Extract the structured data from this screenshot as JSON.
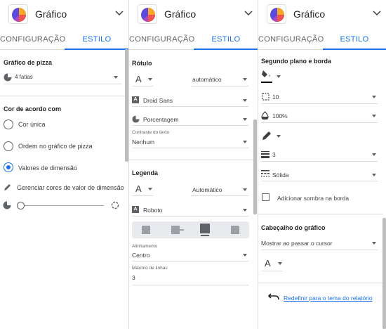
{
  "header": {
    "title": "Gráfico"
  },
  "tabs": {
    "config": "CONFIGURAÇÃO",
    "style": "ESTILO"
  },
  "panel1": {
    "pie_section": "Gráfico de pizza",
    "slices": "4 fatias",
    "color_section": "Cor de acordo com",
    "radio_single": "Cor única",
    "radio_order": "Ordem no gráfico de pizza",
    "radio_dimension": "Valores de dimensão",
    "manage_colors": "Gerenciar cores de valor de dimensão"
  },
  "panel2": {
    "label_section": "Rótulo",
    "label_font_size": "automático",
    "label_font": "Droid Sans",
    "label_type": "Porcentagem",
    "contrast_label": "Contraste do texto",
    "contrast_value": "Nenhum",
    "legend_section": "Legenda",
    "legend_font_size": "Automático",
    "legend_font": "Roboto",
    "align_label": "Alinhamento",
    "align_value": "Centro",
    "max_lines_label": "Máximo de linhas",
    "max_lines_value": "3"
  },
  "panel3": {
    "bg_section": "Segundo plano e borda",
    "radius": "10",
    "opacity": "100%",
    "border_weight": "3",
    "border_style": "Sólida",
    "shadow_label": "Adicionar sombra na borda",
    "chart_header_section": "Cabeçalho do gráfico",
    "header_mode": "Mostrar ao passar o cursor",
    "reset_link": "Redefinir para o tema do relatório"
  },
  "colors": {
    "accent": "#1a73e8",
    "text": "#202124",
    "muted": "#5f6368",
    "divider": "#dadce0"
  },
  "icons": [
    "pie-chart-icon",
    "chevron-down-icon",
    "font-size-icon",
    "font-icon",
    "pie-icon",
    "paint-bucket-icon",
    "border-radius-icon",
    "opacity-icon",
    "pen-icon",
    "line-weight-icon",
    "line-style-icon",
    "undo-icon"
  ]
}
